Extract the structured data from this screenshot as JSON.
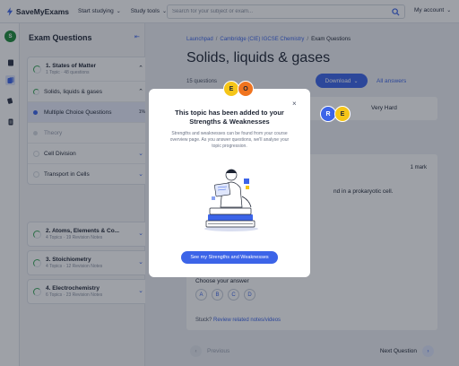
{
  "brand": {
    "name": "SaveMyExams"
  },
  "nav": {
    "menu": [
      {
        "label": "Start studying"
      },
      {
        "label": "Study tools"
      }
    ],
    "search_placeholder": "Search for your subject or exam...",
    "account_label": "My account"
  },
  "rail": {
    "avatar_letter": "S"
  },
  "sidebar": {
    "title": "Exam Questions",
    "topics": [
      {
        "name": "1. States of Matter",
        "meta": "1 Topic · 48 questions"
      },
      {
        "name": "2. Atoms, Elements & Co...",
        "meta": "4 Topics · 19 Revision Notes"
      },
      {
        "name": "3. Stoichiometry",
        "meta": "4 Topics · 12 Revision Notes"
      },
      {
        "name": "4. Electrochemistry",
        "meta": "6 Topics · 23 Revision Notes"
      }
    ],
    "subtopics": [
      {
        "label": "Solids, liquids & gases"
      },
      {
        "label": "Multiple Choice Questions",
        "pct": "1%"
      },
      {
        "label": "Theory"
      },
      {
        "label": "Cell Division"
      },
      {
        "label": "Transport in Cells"
      }
    ]
  },
  "main": {
    "breadcrumbs": [
      "Launchpad",
      "Cambridge (CIE) IGCSE Chemistry",
      "Exam Questions"
    ],
    "title": "Solids, liquids & gases",
    "question_count": "15 questions",
    "download_label": "Download",
    "all_answers_label": "All answers",
    "difficulty_label": "Very Hard",
    "mark_label": "1 mark",
    "question_text_fragment": "nd in a prokaryotic cell.",
    "choose_label": "Choose your answer",
    "options": [
      "A",
      "B",
      "C",
      "D"
    ],
    "stuck_label": "Stuck?",
    "stuck_link": "Review related notes/videos",
    "prev_label": "Previous",
    "next_label": "Next Question"
  },
  "modal": {
    "title_line1": "This topic has been added to your",
    "title_line2": "Strengths & Weaknesses",
    "body": "Strengths and weaknesses can be found from your course overview page. As you answer questions, we'll analyse your topic progression.",
    "cta_label": "See my Strengths and Weaknesses",
    "close_glyph": "×"
  },
  "badges": [
    {
      "letter": "E",
      "color": "#f5c518"
    },
    {
      "letter": "O",
      "color": "#f0741f"
    },
    {
      "letter": "R",
      "color": "#3c64e8"
    },
    {
      "letter": "E",
      "color": "#f5c518"
    }
  ],
  "icons": {
    "logo": "lightning-bolt-icon",
    "search": "search-icon",
    "close": "close-icon",
    "chevron": "chevron-down-icon"
  },
  "colors": {
    "accent": "#3c64e8",
    "success": "#3aa75a",
    "brand_green": "#1d8a3a"
  }
}
